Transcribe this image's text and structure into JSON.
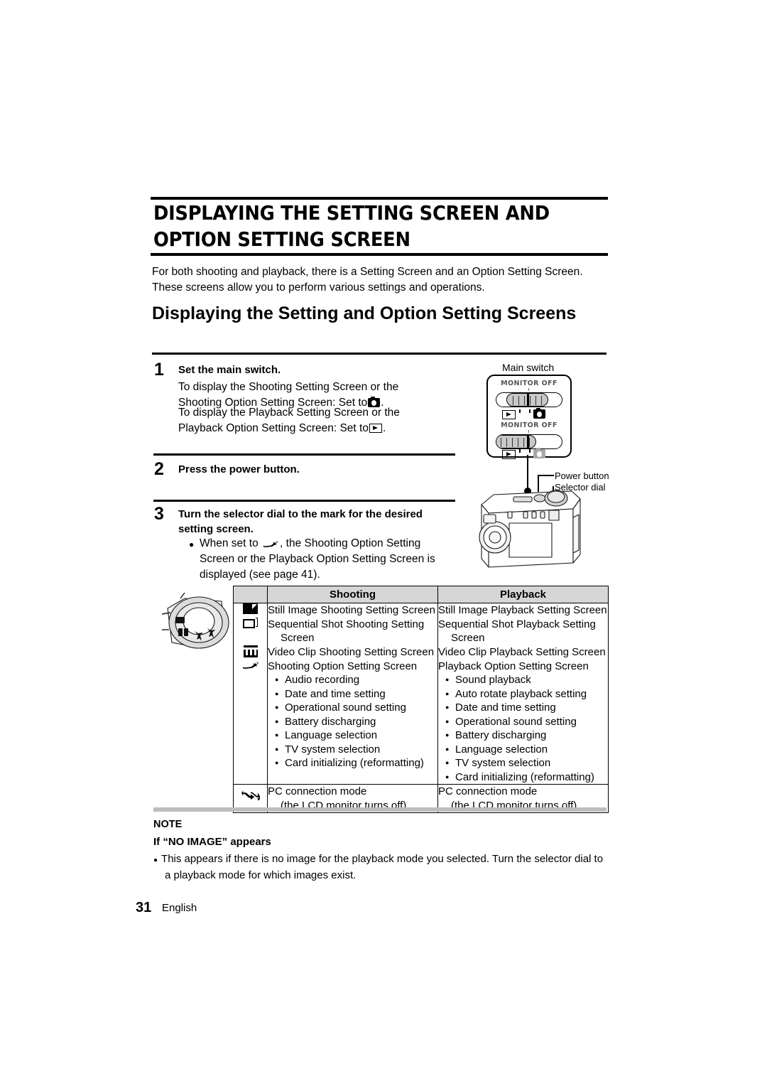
{
  "document": {
    "chapter_title": "DISPLAYING THE SETTING SCREEN AND OPTION SETTING SCREEN",
    "intro": "For both shooting and playback, there is a Setting Screen and an Option Setting Screen. These screens allow you to perform various settings and operations.",
    "section_title": "Displaying the Setting and Option Setting Screens"
  },
  "steps": [
    {
      "number": "1",
      "title": "Set the main switch.",
      "body_1": "To display the Shooting Setting Screen or the Shooting Option Setting Screen: Set to",
      "body_1_end": ".",
      "body_2": "To display the Playback Setting Screen or the Playback Option Setting Screen: Set to",
      "body_2_end": ".",
      "icon_1": "camera-icon",
      "icon_2": "play-icon"
    },
    {
      "number": "2",
      "title": "Press the power button."
    },
    {
      "number": "3",
      "title": "Turn the selector dial to the mark for the desired setting screen.",
      "bullet_pre": "When set to",
      "bullet_post": ", the Shooting Option Setting Screen or the Playback Option Setting Screen is displayed (see page 41).",
      "bullet_icon": "wrench-icon"
    }
  ],
  "illustration": {
    "main_switch_label": "Main switch",
    "monitor_off_upper": "MONITOR OFF",
    "monitor_off_lower": "MONITOR OFF",
    "power_button_label": "Power button",
    "selector_dial_label": "Selector dial",
    "icons": {
      "play": "play-icon",
      "camera": "camera-icon",
      "camera_lower": "camera-icon-dim"
    }
  },
  "table": {
    "headers": {
      "icon": "",
      "shooting": "Shooting",
      "playback": "Playback"
    },
    "rows": [
      {
        "icon": "still-image-icon",
        "shooting": "Still Image Shooting Setting Screen",
        "playback": "Still Image Playback Setting Screen"
      },
      {
        "icon": "sequential-shot-icon",
        "shooting": "Sequential Shot Shooting Setting Screen",
        "playback": "Sequential Shot Playback Setting Screen"
      },
      {
        "icon": "video-clip-icon",
        "shooting": "Video Clip Shooting Setting Screen",
        "playback": "Video Clip Playback Setting Screen"
      },
      {
        "icon": "wrench-icon",
        "shooting": "Shooting Option Setting Screen",
        "playback": "Playback Option Setting Screen",
        "shooting_bullets": [
          "Audio recording",
          "Date and time setting",
          "Operational sound setting",
          "Battery discharging",
          "Language selection",
          "TV system selection",
          "Card initializing (reformatting)"
        ],
        "playback_bullets": [
          "Sound playback",
          "Auto rotate playback setting",
          "Date and time setting",
          "Operational sound setting",
          "Battery discharging",
          "Language selection",
          "TV system selection",
          "Card initializing (reformatting)"
        ]
      },
      {
        "icon": "pc-connection-icon",
        "shooting": "PC connection mode",
        "shooting_sub": "(the LCD monitor turns off)",
        "playback": "PC connection mode",
        "playback_sub": "(the LCD monitor turns off)"
      }
    ]
  },
  "note": {
    "heading": "NOTE",
    "subheading": "If “NO IMAGE” appears",
    "body": "This appears if there is no image for the playback mode you selected. Turn the selector dial to a playback mode for which images exist."
  },
  "footer": {
    "page_number": "31",
    "language": "English"
  }
}
